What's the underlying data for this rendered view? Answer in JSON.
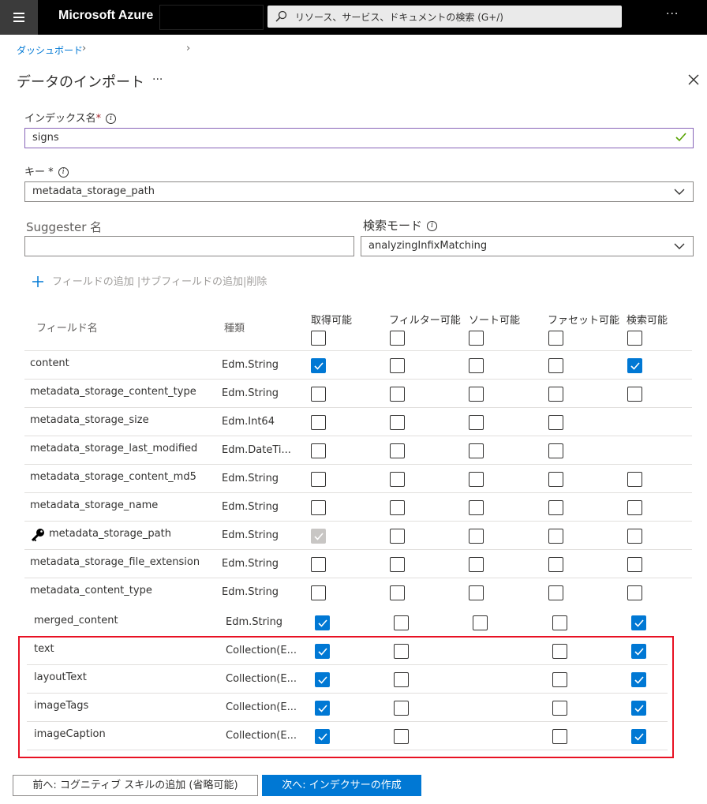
{
  "topbar": {
    "brand": "Microsoft Azure",
    "search_placeholder": "リソース、サービス、ドキュメントの検索 (G+/)",
    "more": "···"
  },
  "breadcrumb": {
    "item": "ダッシュボード"
  },
  "page": {
    "title": "データのインポート",
    "more": "···"
  },
  "index_name": {
    "label": "インデックス名",
    "required_mark": "*",
    "value": "signs"
  },
  "key": {
    "label": "キー *",
    "value": "metadata_storage_path"
  },
  "suggester": {
    "label": "Suggester 名",
    "value": ""
  },
  "search_mode": {
    "label": "検索モード",
    "value": "analyzingInfixMatching"
  },
  "add_field": {
    "text": "フィールドの追加 |サブフィールドの追加|削除"
  },
  "table": {
    "headers": {
      "field_name": "フィールド名",
      "type": "種類",
      "retrievable": "取得可能",
      "filterable": "フィルター可能",
      "sortable": "ソート可能",
      "facetable": "ファセット可能",
      "searchable": "検索可能"
    },
    "rows": [
      {
        "name": "content",
        "type": "Edm.String",
        "flags": [
          1,
          0,
          0,
          0,
          1
        ]
      },
      {
        "name": "metadata_storage_content_type",
        "type": "Edm.String",
        "flags": [
          0,
          0,
          0,
          0,
          0
        ]
      },
      {
        "name": "metadata_storage_size",
        "type": "Edm.Int64",
        "flags": [
          0,
          0,
          0,
          0,
          null
        ]
      },
      {
        "name": "metadata_storage_last_modified",
        "type": "Edm.DateTi...",
        "flags": [
          0,
          0,
          0,
          0,
          null
        ]
      },
      {
        "name": "metadata_storage_content_md5",
        "type": "Edm.String",
        "flags": [
          0,
          0,
          0,
          0,
          0
        ]
      },
      {
        "name": "metadata_storage_name",
        "type": "Edm.String",
        "flags": [
          0,
          0,
          0,
          0,
          0
        ]
      },
      {
        "name": "metadata_storage_path",
        "type": "Edm.String",
        "flags": [
          2,
          0,
          0,
          0,
          0
        ],
        "key": true
      },
      {
        "name": "metadata_storage_file_extension",
        "type": "Edm.String",
        "flags": [
          0,
          0,
          0,
          0,
          0
        ]
      },
      {
        "name": "metadata_content_type",
        "type": "Edm.String",
        "flags": [
          0,
          0,
          0,
          0,
          0
        ]
      },
      {
        "name": "merged_content",
        "type": "Edm.String",
        "flags": [
          1,
          0,
          0,
          0,
          1
        ]
      },
      {
        "name": "text",
        "type": "Collection(E...",
        "flags": [
          1,
          0,
          null,
          0,
          1
        ]
      },
      {
        "name": "layoutText",
        "type": "Collection(E...",
        "flags": [
          1,
          0,
          null,
          0,
          1
        ]
      },
      {
        "name": "imageTags",
        "type": "Collection(E...",
        "flags": [
          1,
          0,
          null,
          0,
          1
        ]
      },
      {
        "name": "imageCaption",
        "type": "Collection(E...",
        "flags": [
          1,
          0,
          null,
          0,
          1
        ]
      }
    ]
  },
  "buttons": {
    "prev": "前へ: コグニティブ スキルの追加 (省略可能)",
    "next": "次へ: インデクサーの作成"
  },
  "colors": {
    "accent": "#0078d4",
    "highlight_border": "#e81123"
  }
}
